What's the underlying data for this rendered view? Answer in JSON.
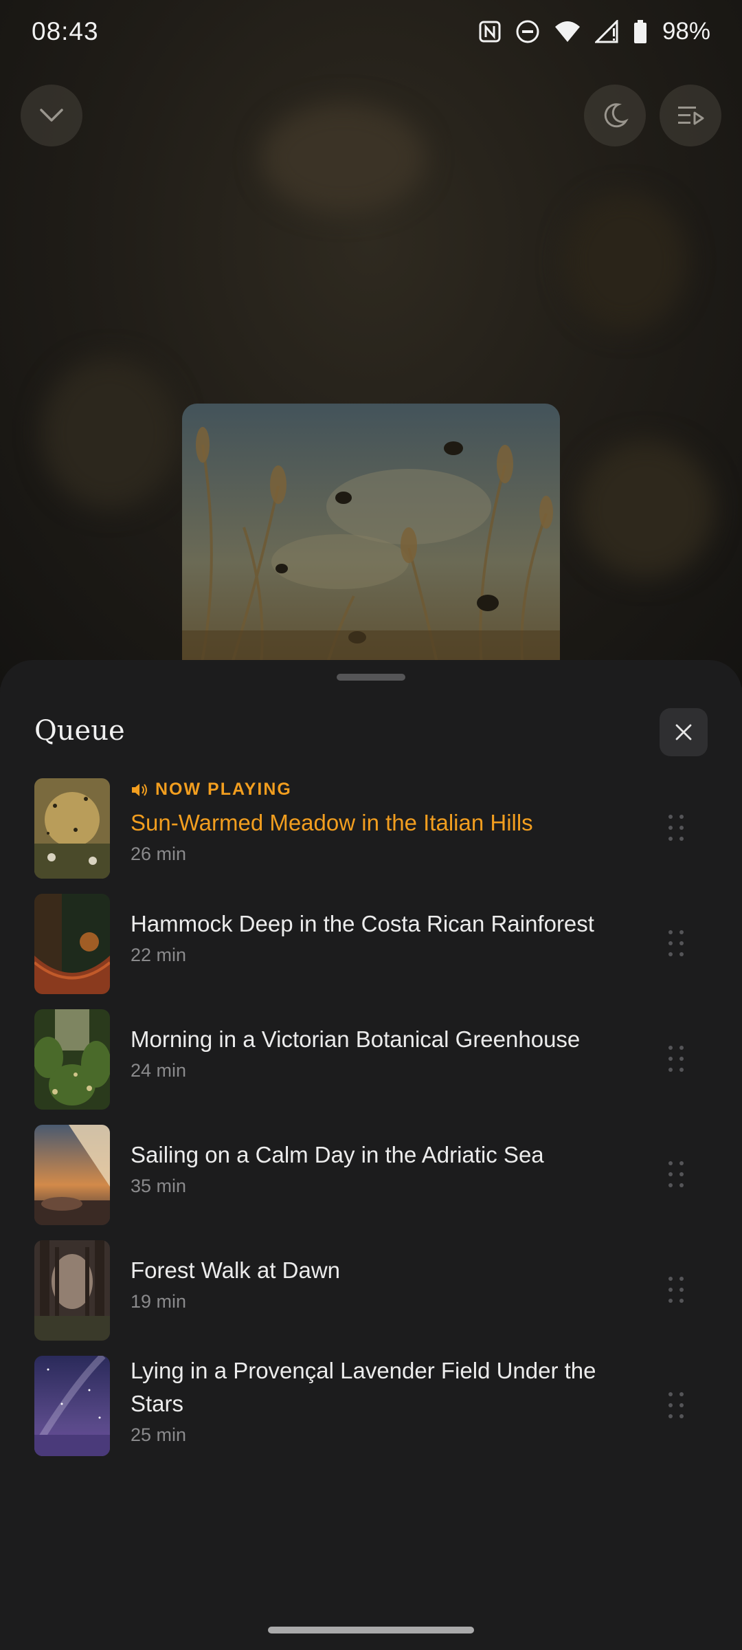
{
  "status_bar": {
    "time": "08:43",
    "battery": "98%",
    "icons": [
      "nfc-icon",
      "do-not-disturb-icon",
      "wifi-icon",
      "signal-icon",
      "battery-icon"
    ]
  },
  "player": {
    "buttons": [
      "collapse-chevron-icon",
      "sleep-timer-moon-icon",
      "queue-icon"
    ]
  },
  "queue": {
    "title": "Queue",
    "close_icon": "close-icon",
    "now_playing_label": "NOW PLAYING",
    "items": [
      {
        "title": "Sun-Warmed Meadow in the Italian Hills",
        "duration": "26 min",
        "playing": true
      },
      {
        "title": "Hammock Deep in the Costa Rican Rainforest",
        "duration": "22 min",
        "playing": false
      },
      {
        "title": "Morning in a Victorian Botanical Greenhouse",
        "duration": "24 min",
        "playing": false
      },
      {
        "title": "Sailing on a Calm Day in the Adriatic Sea",
        "duration": "35 min",
        "playing": false
      },
      {
        "title": "Forest Walk at Dawn",
        "duration": "19 min",
        "playing": false
      },
      {
        "title": "Lying in a Provençal Lavender Field Under the Stars",
        "duration": "25 min",
        "playing": false
      }
    ]
  },
  "colors": {
    "accent": "#f29e1f",
    "sheet_background": "#1c1c1d",
    "secondary_text": "#8a8a8c"
  }
}
